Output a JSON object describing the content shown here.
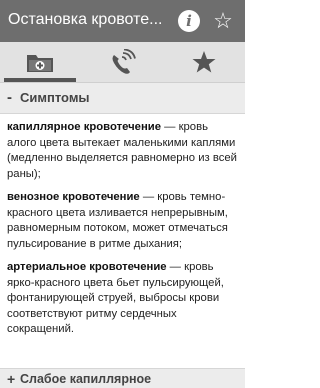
{
  "header": {
    "title": "Остановка кровоте...",
    "info_icon": "info-icon",
    "favorite_icon": "star-outline-icon"
  },
  "tabs": [
    {
      "icon": "first-aid-folder-icon",
      "active": true
    },
    {
      "icon": "phone-call-icon",
      "active": false
    },
    {
      "icon": "star-icon",
      "active": false
    }
  ],
  "section": {
    "sign": "-",
    "title": "Симптомы"
  },
  "paragraphs": [
    {
      "term": "капиллярное кровотечение",
      "text": " — кровь алого цвета вытекает маленькими каплями (медленно выделяется равномерно из всей раны);"
    },
    {
      "term": "венозное кровотечение",
      "text": " — кровь темно-красного цвета изливается непрерывным, равномерным потоком, может отмечаться пульсирование в ритме дыхания;"
    },
    {
      "term": "артериальное кровотечение",
      "text": " — кровь ярко-красного цвета бьет пульсирующей, фонтанирующей струей, выбросы крови соответствуют ритму сердечных сокращений."
    }
  ],
  "next_section": {
    "sign": "+",
    "title": "Слабое капиллярное"
  },
  "colors": {
    "titlebar": "#6e6e6e",
    "tabbar": "#e2e2e2",
    "section_bg": "#ececec"
  }
}
